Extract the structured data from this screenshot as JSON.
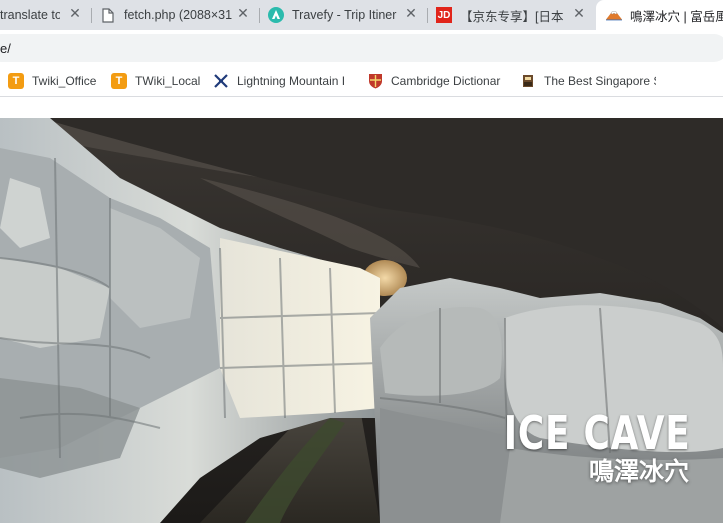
{
  "tabs": [
    {
      "title": "translate to",
      "icon": "none"
    },
    {
      "title": "fetch.php (2088×31",
      "icon": "document-icon"
    },
    {
      "title": "Travefy - Trip Itiner",
      "icon": "travefy-icon"
    },
    {
      "title": "【京东专享】[日本东",
      "icon": "jd-icon",
      "icon_text": "JD"
    },
    {
      "title": "鳴澤冰穴 | 富岳風",
      "icon": "fuji-icon",
      "active": true
    }
  ],
  "address": {
    "url": "e/"
  },
  "bookmarks": [
    {
      "label": "Twiki_Office",
      "icon": "twiki-icon",
      "icon_text": "T"
    },
    {
      "label": "TWiki_Local",
      "icon": "twiki-icon",
      "icon_text": "T"
    },
    {
      "label": "Lightning Mountain I",
      "icon": "lightning-mountain-icon"
    },
    {
      "label": "Cambridge Dictionar",
      "icon": "cambridge-shield-icon"
    },
    {
      "label": "The Best Singapore S",
      "icon": "singapore-icon"
    }
  ],
  "hero": {
    "title": "ICE CAVE",
    "subtitle": "鳴澤冰穴"
  },
  "colors": {
    "tabstrip": "#dee1e6",
    "twiki": "#f39c12",
    "jd": "#e1251b",
    "travefy": "#2bbbad"
  }
}
